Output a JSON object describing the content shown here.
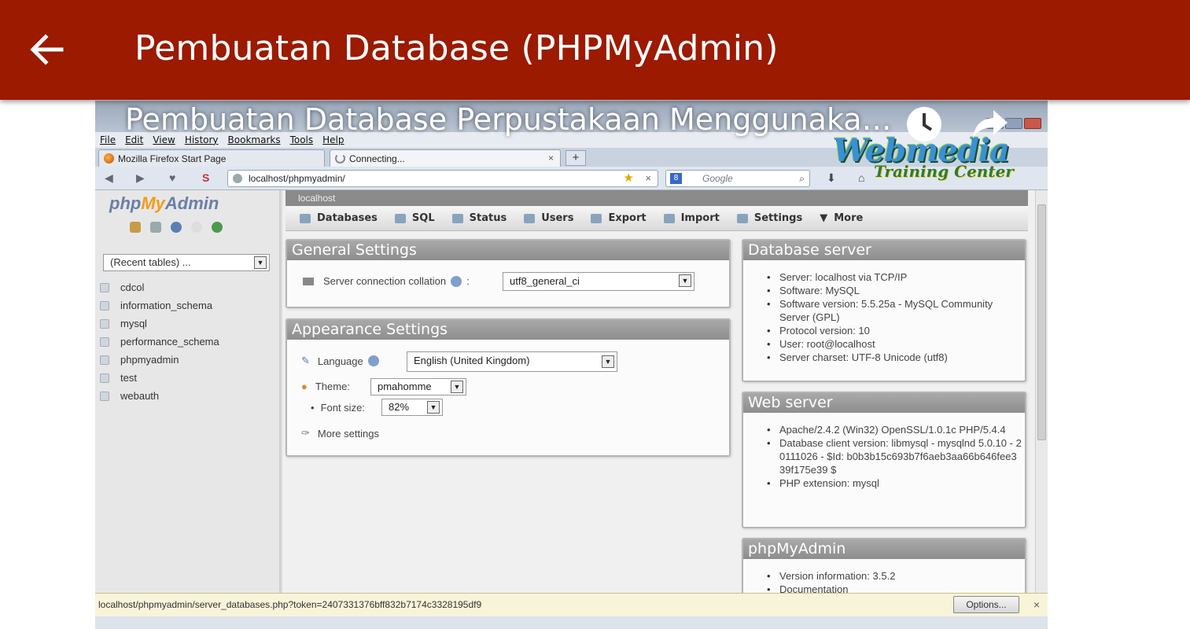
{
  "app": {
    "title": "Pembuatan Database (PHPMyAdmin)"
  },
  "video": {
    "title": "Pembuatan Database Perpustakaan Menggunaka…",
    "icons": [
      "watch-later-icon",
      "share-icon"
    ]
  },
  "browser": {
    "menu": [
      "File",
      "Edit",
      "View",
      "History",
      "Bookmarks",
      "Tools",
      "Help"
    ],
    "tabs": [
      {
        "label": "Mozilla Firefox Start Page"
      },
      {
        "label": "Connecting..."
      }
    ],
    "new_tab": "+",
    "url": "localhost/phpmyadmin/",
    "search_placeholder": "Google",
    "status_url": "localhost/phpmyadmin/server_databases.php?token=2407331376bff832b7174c3328195df9",
    "options_label": "Options...",
    "close_glyph": "×"
  },
  "overlay_logo": {
    "line1": "Webmedia",
    "line2": "Training Center"
  },
  "pma": {
    "logo_php": "php",
    "logo_my": "My",
    "logo_admin": "Admin",
    "recent_tables": "(Recent tables) ...",
    "databases": [
      "cdcol",
      "information_schema",
      "mysql",
      "performance_schema",
      "phpmyadmin",
      "test",
      "webauth"
    ],
    "breadcrumb": "localhost",
    "tabs": [
      "Databases",
      "SQL",
      "Status",
      "Users",
      "Export",
      "Import",
      "Settings",
      "More"
    ],
    "general": {
      "title": "General Settings",
      "collation_label": "Server connection collation",
      "collation_value": "utf8_general_ci"
    },
    "appearance": {
      "title": "Appearance Settings",
      "language_label": "Language",
      "language_value": "English (United Kingdom)",
      "theme_label": "Theme:",
      "theme_value": "pmahomme",
      "fontsize_label": "Font size:",
      "fontsize_value": "82%",
      "more_settings": "More settings"
    },
    "db_server": {
      "title": "Database server",
      "items": [
        "Server: localhost via TCP/IP",
        "Software: MySQL",
        "Software version: 5.5.25a - MySQL Community Server (GPL)",
        "Protocol version: 10",
        "User: root@localhost",
        "Server charset: UTF-8 Unicode (utf8)"
      ]
    },
    "web_server": {
      "title": "Web server",
      "items": [
        "Apache/2.4.2 (Win32) OpenSSL/1.0.1c PHP/5.4.4",
        "Database client version: libmysql - mysqlnd 5.0.10 - 20111026 - $Id: b0b3b15c693b7f6aeb3aa66b646fee339f175e39 $",
        "PHP extension: mysql"
      ]
    },
    "pma_info": {
      "title": "phpMyAdmin",
      "items": [
        "Version information: 3.5.2",
        "Documentation"
      ]
    }
  }
}
